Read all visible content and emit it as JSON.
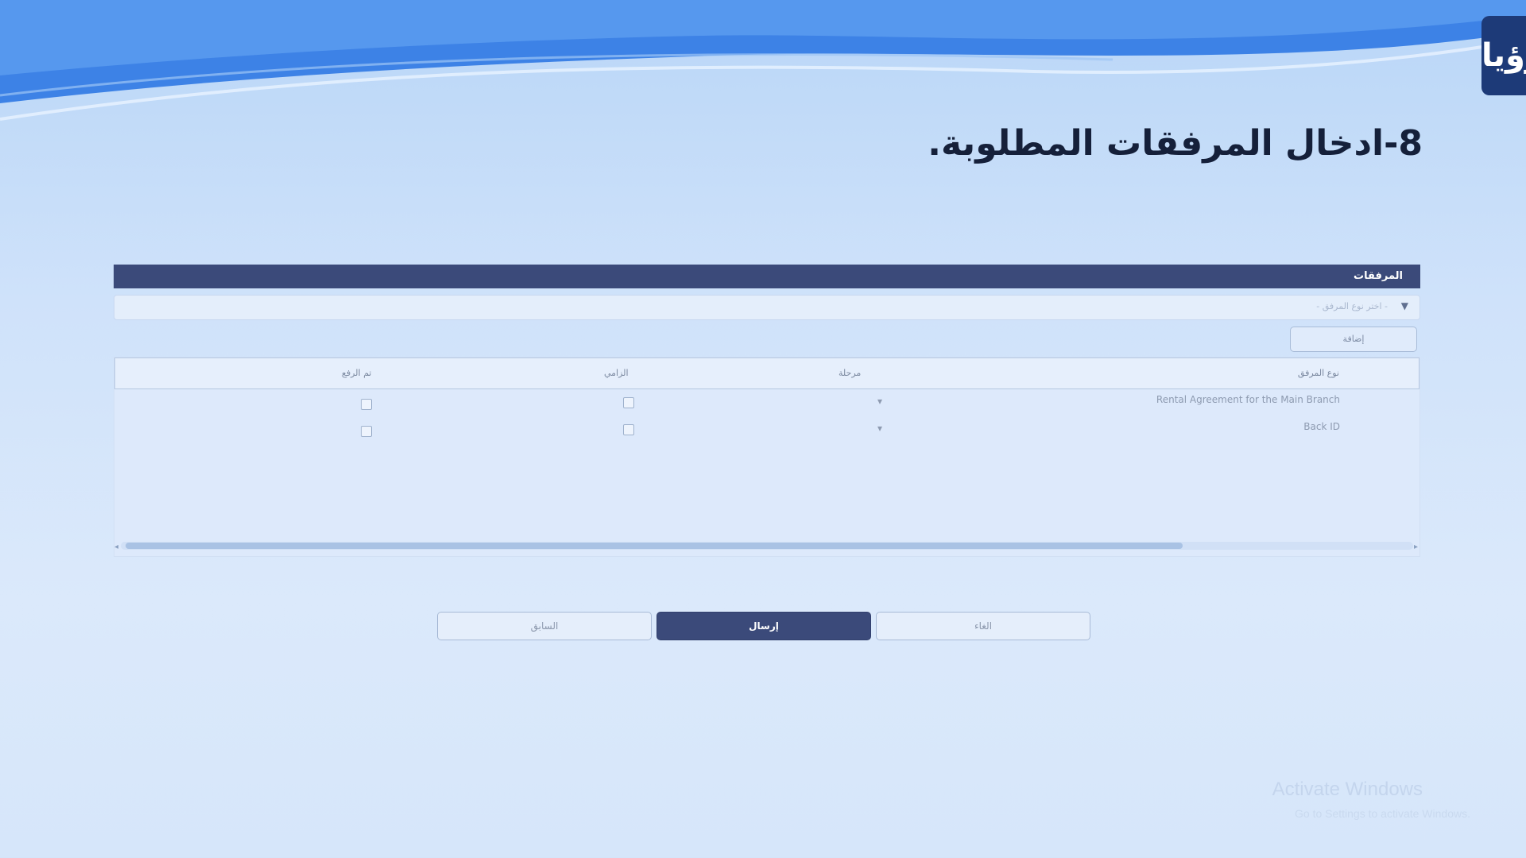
{
  "slide": {
    "title": "8-ادخال المرفقات المطلوبة.",
    "logo_text": "رؤيا"
  },
  "panel": {
    "header": "المرفقات",
    "select_placeholder": "- اختر نوع المرفق -",
    "add_button": "إضافة"
  },
  "table": {
    "columns": [
      "نوع المرفق",
      "مرحلة",
      "الزامي",
      "تم الرفع"
    ],
    "rows": [
      {
        "name": "Rental Agreement for the Main Branch",
        "stage": "▾"
      },
      {
        "name": "Back ID",
        "stage": "▾"
      }
    ]
  },
  "footer": {
    "prev_label": "السابق",
    "submit_label": "إرسال",
    "cancel_label": "الغاء"
  },
  "watermark": {
    "title": "Activate Windows",
    "subtitle": "Go to Settings to activate Windows."
  }
}
